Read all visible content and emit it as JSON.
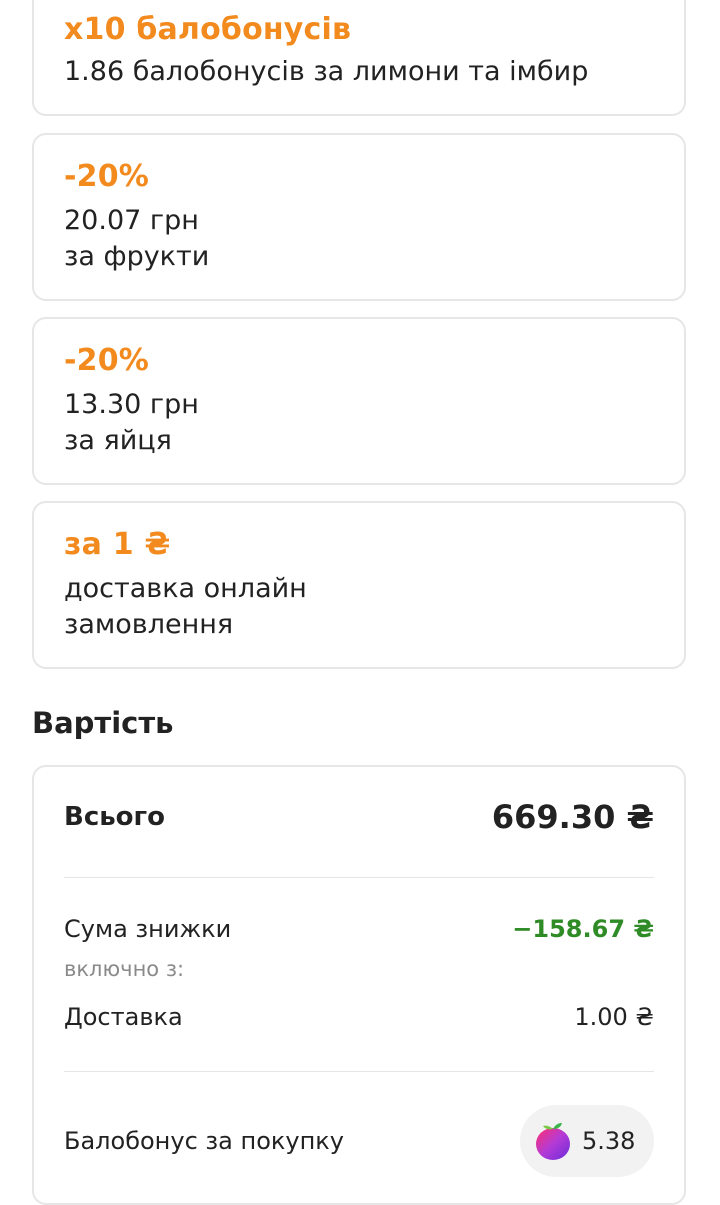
{
  "promos": [
    {
      "title": "x10 балобонусів",
      "line1": "1.86 балобонусів за лимони та імбир",
      "line2": ""
    },
    {
      "title": "-20%",
      "line1": "20.07 грн",
      "line2": "за фрукти"
    },
    {
      "title": "-20%",
      "line1": "13.30 грн",
      "line2": "за яйця"
    },
    {
      "title": "за 1 ₴",
      "line1": "доставка онлайн",
      "line2": "замовлення"
    }
  ],
  "cost": {
    "section_title": "Вартість",
    "total_label": "Всього",
    "total_value": "669.30 ₴",
    "discount_label": "Сума знижки",
    "discount_value": "−158.67 ₴",
    "including_label": "включно з:",
    "delivery_label": "Доставка",
    "delivery_value": "1.00 ₴",
    "bonus_label": "Балобонус за покупку",
    "bonus_value": "5.38"
  },
  "colors": {
    "accent_orange": "#f28a1e",
    "discount_green": "#2e8b25",
    "border": "#e6e6e6"
  },
  "icons": {
    "bonus": "fruit-plum-icon"
  }
}
